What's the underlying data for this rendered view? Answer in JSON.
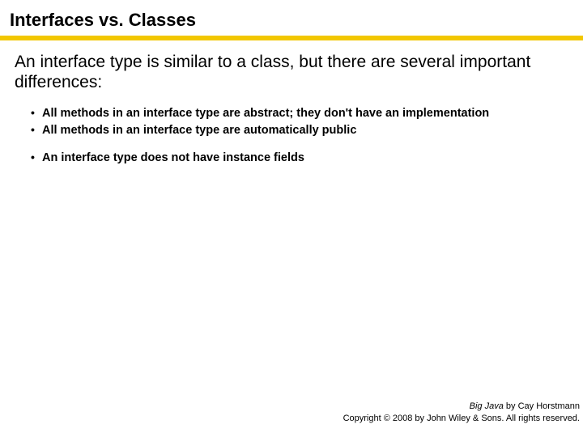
{
  "slide": {
    "title": "Interfaces vs. Classes",
    "intro": "An interface type is similar to a class, but there are several important differences:",
    "bullets": [
      "All methods in an interface type are abstract; they don't have an implementation",
      "All methods in an interface type are automatically public",
      "An interface type does not have instance fields"
    ],
    "footer": {
      "book_title": "Big Java",
      "byline": " by Cay Horstmann",
      "copyright": "Copyright © 2008 by John Wiley & Sons. All rights reserved."
    }
  }
}
